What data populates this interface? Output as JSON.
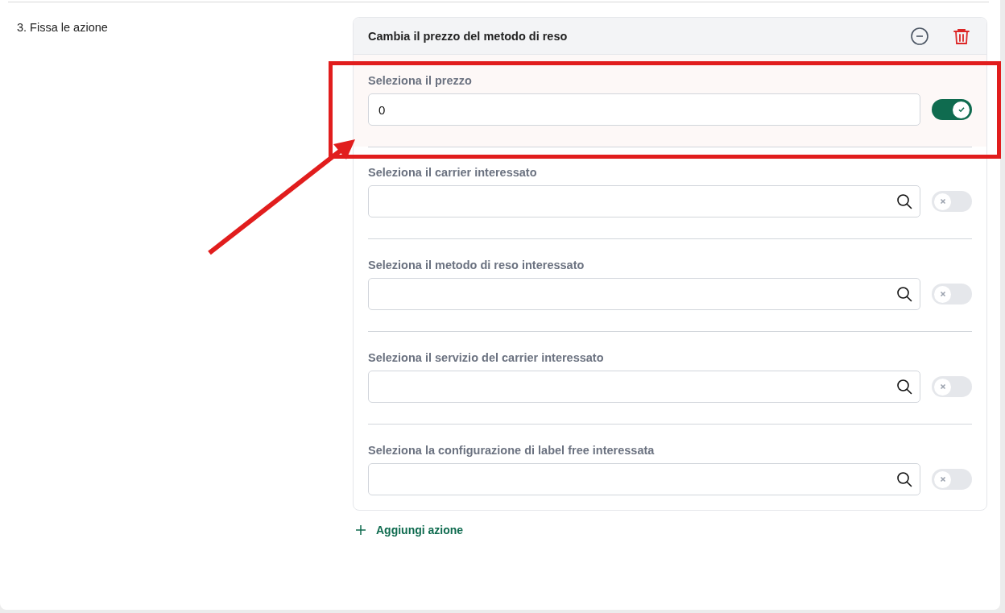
{
  "step_label": "3. Fissa le azione",
  "action": {
    "title": "Cambia il prezzo del metodo di reso",
    "fields": [
      {
        "kind": "number",
        "label": "Seleziona il prezzo",
        "value": "0",
        "on": true,
        "highlighted": true
      },
      {
        "kind": "search",
        "label": "Seleziona il carrier interessato",
        "on": false,
        "highlighted": false
      },
      {
        "kind": "search",
        "label": "Seleziona il metodo di reso interessato",
        "on": false,
        "highlighted": false
      },
      {
        "kind": "search",
        "label": "Seleziona il servizio del carrier interessato",
        "on": false,
        "highlighted": false
      },
      {
        "kind": "search",
        "label": "Seleziona la configurazione di label free interessata",
        "on": false,
        "highlighted": false
      }
    ]
  },
  "add_button": {
    "label": "Aggiungi azione"
  }
}
